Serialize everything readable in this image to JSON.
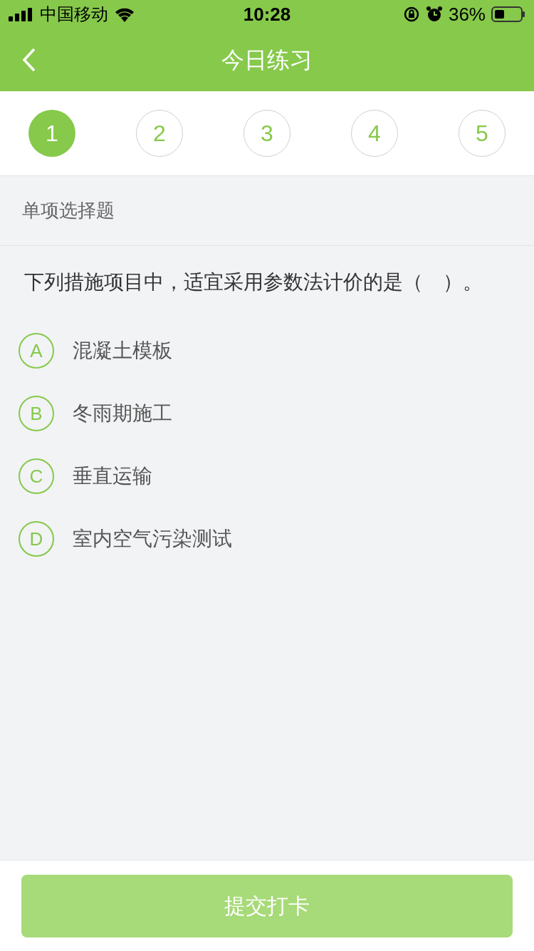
{
  "status_bar": {
    "carrier": "中国移动",
    "time": "10:28",
    "battery": "36%"
  },
  "nav": {
    "title": "今日练习"
  },
  "steps": [
    {
      "label": "1",
      "selected": true
    },
    {
      "label": "2",
      "selected": false
    },
    {
      "label": "3",
      "selected": false
    },
    {
      "label": "4",
      "selected": false
    },
    {
      "label": "5",
      "selected": false
    }
  ],
  "section_title": "单项选择题",
  "question": "下列措施项目中，适宜采用参数法计价的是（　）。",
  "options": [
    {
      "letter": "A",
      "text": "混凝土模板",
      "selected": false
    },
    {
      "letter": "B",
      "text": "冬雨期施工",
      "selected": false
    },
    {
      "letter": "C",
      "text": "垂直运输",
      "selected": false
    },
    {
      "letter": "D",
      "text": "室内空气污染测试",
      "selected": false
    }
  ],
  "submit": {
    "label": "提交打卡",
    "disabled": true
  }
}
